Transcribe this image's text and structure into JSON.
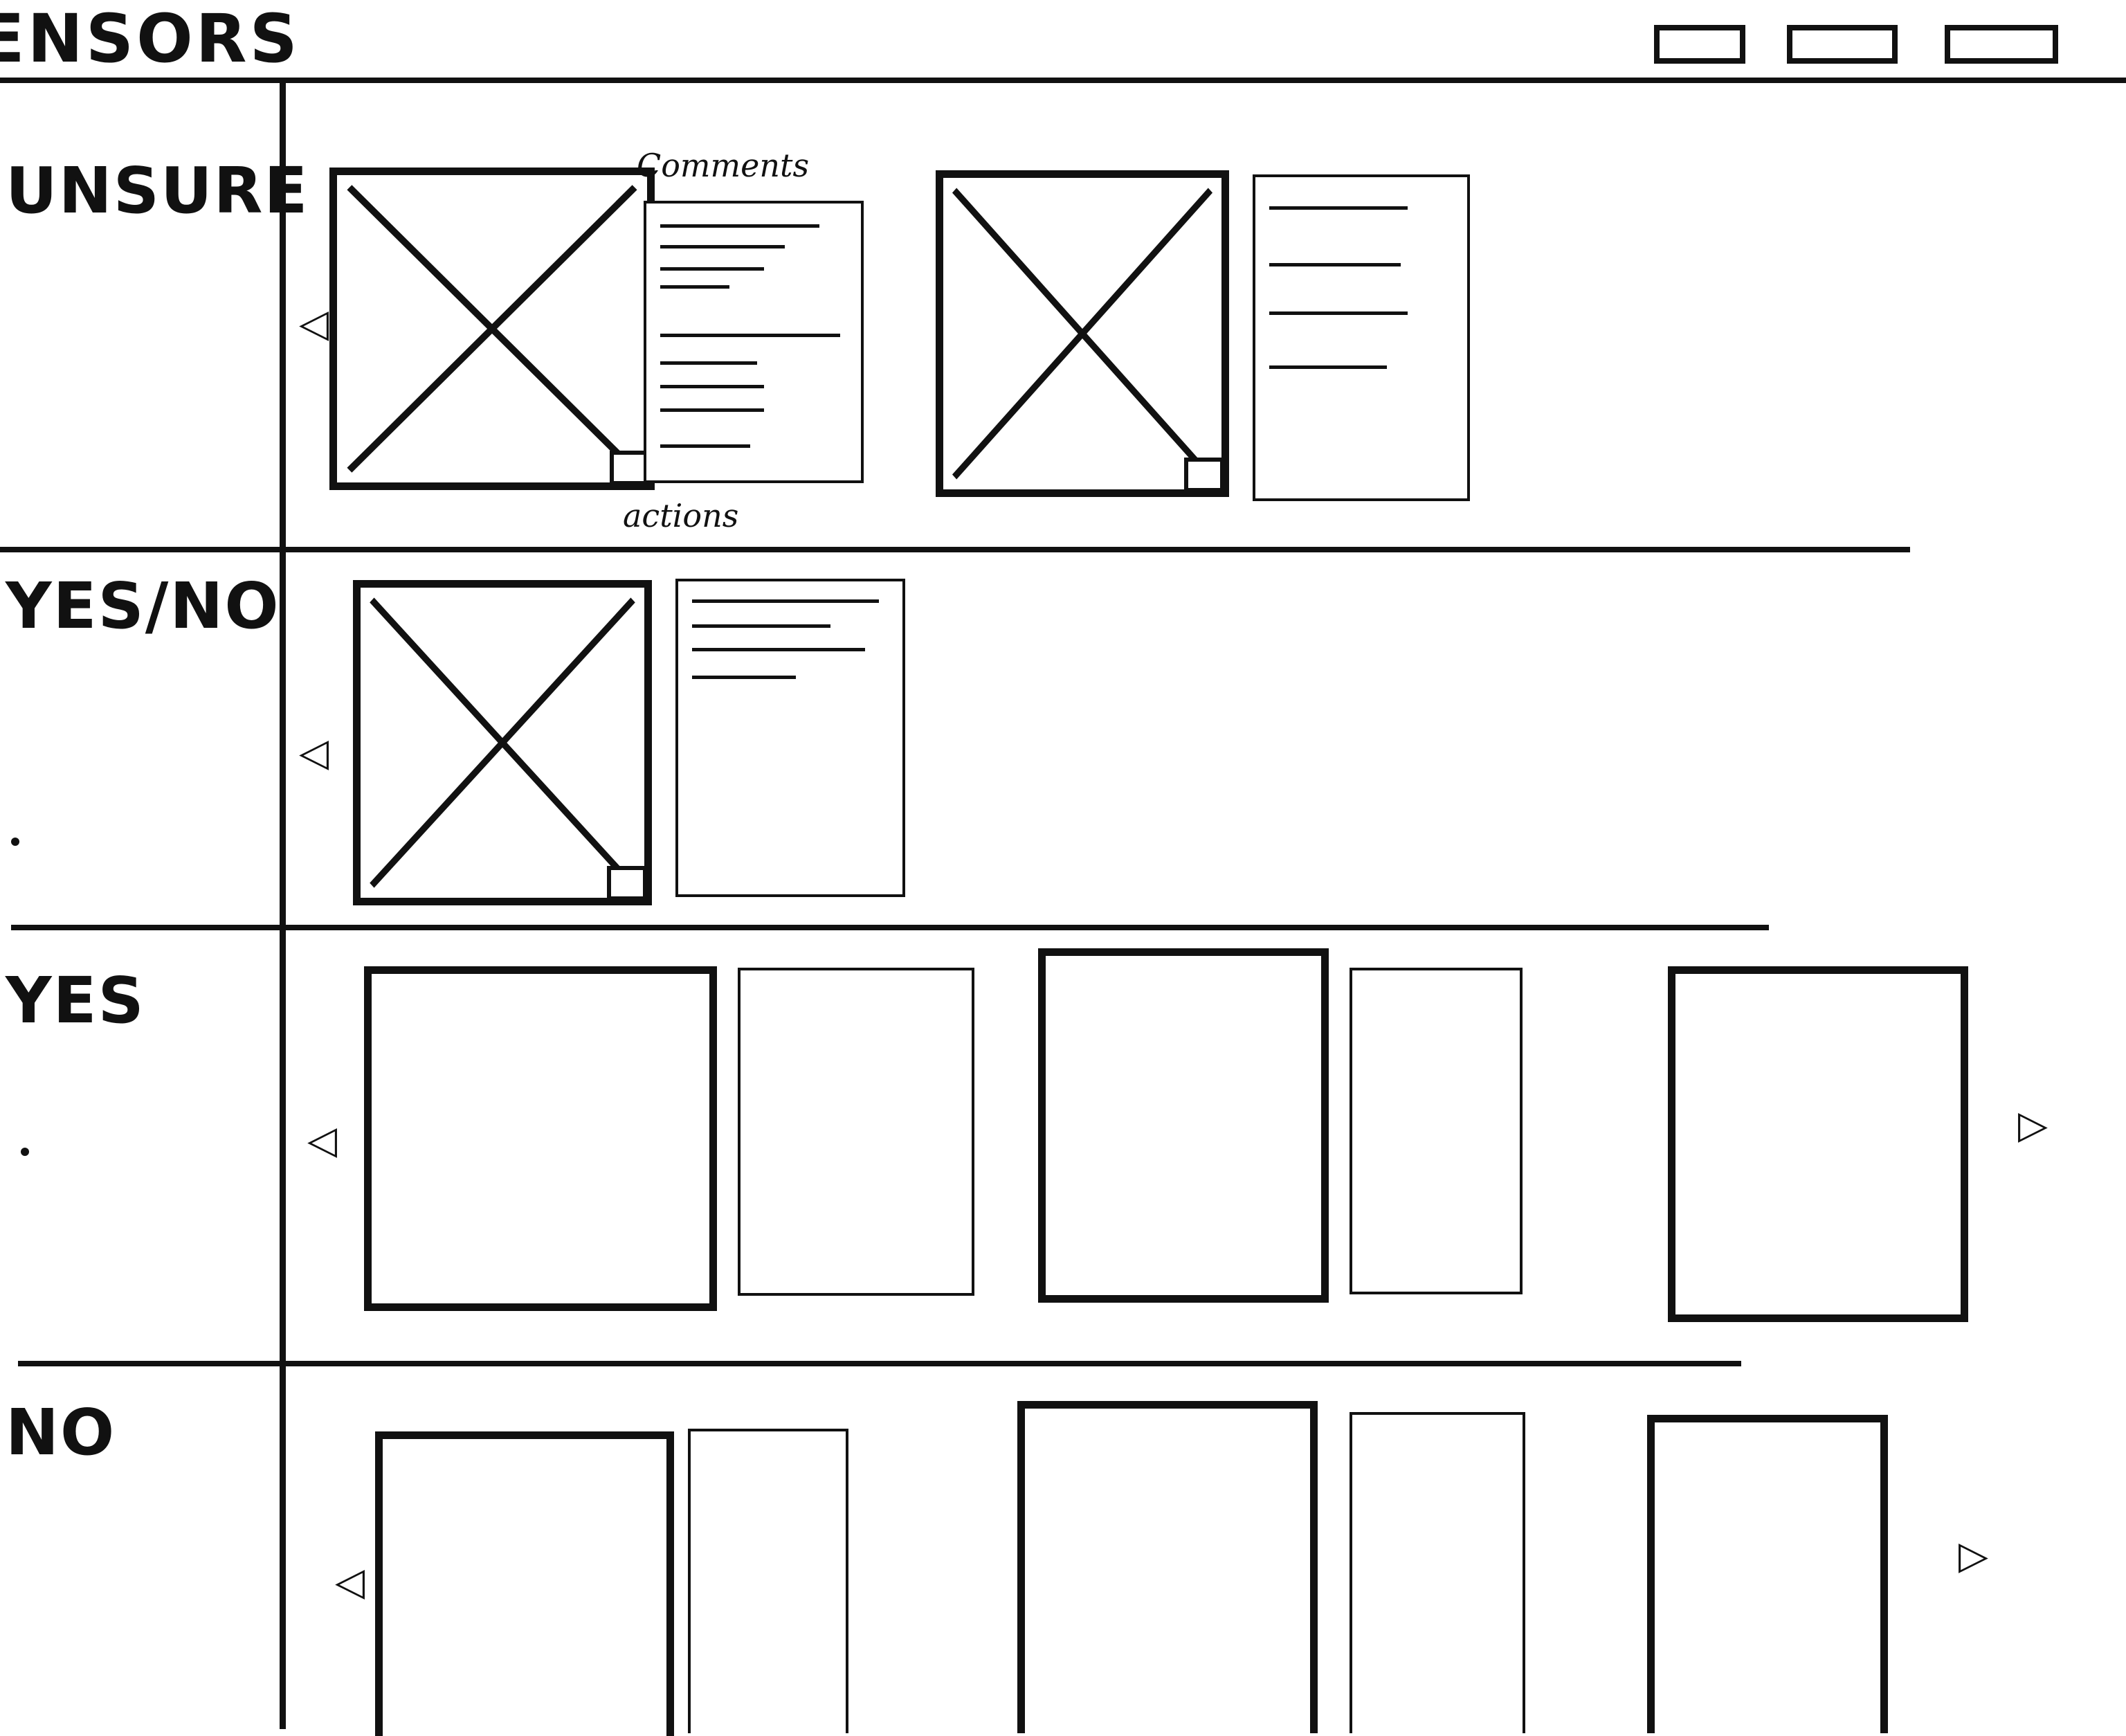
{
  "header": {
    "title": "ENSORS",
    "buttons": [
      "view-button-1",
      "view-button-2",
      "view-button-3"
    ]
  },
  "categories": [
    {
      "label": "UNSURE"
    },
    {
      "label": "YES/NO"
    },
    {
      "label": "YES"
    },
    {
      "label": "NO"
    }
  ],
  "annotations": {
    "comments": "Comments",
    "actions": "actions"
  },
  "icons": {
    "prev": "scroll-left-icon",
    "next": "scroll-right-icon",
    "placeholder": "image-placeholder-icon"
  }
}
